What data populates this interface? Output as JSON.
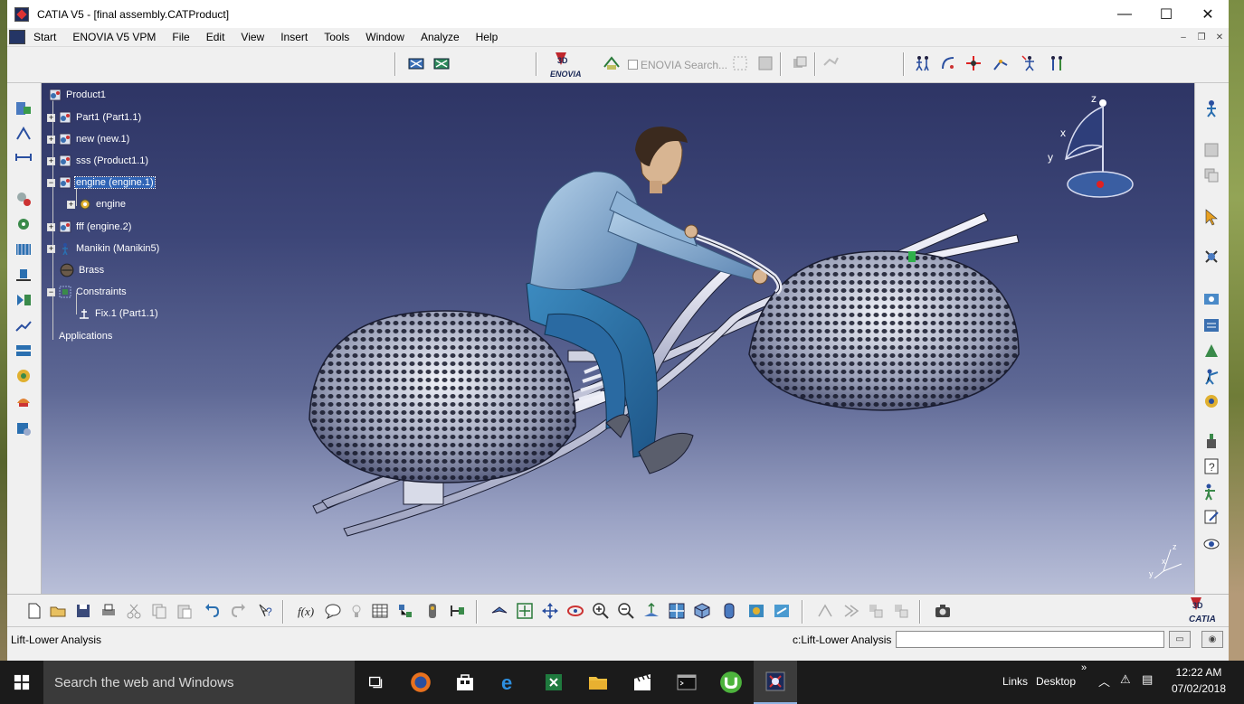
{
  "window": {
    "title": "CATIA V5 - [final assembly.CATProduct]",
    "controls": {
      "minimize": "—",
      "maximize": "☐",
      "close": "✕"
    }
  },
  "menubar": {
    "items": [
      "Start",
      "ENOVIA V5 VPM",
      "File",
      "Edit",
      "View",
      "Insert",
      "Tools",
      "Window",
      "Analyze",
      "Help"
    ],
    "mdi": {
      "minimize": "–",
      "restore": "❐",
      "close": "✕"
    }
  },
  "top_toolbar": {
    "enovia_search_label": "ENOVIA Search..."
  },
  "spec_tree": {
    "nodes": [
      {
        "label": "Product1",
        "icon": "product-icon"
      },
      {
        "label": "Part1 (Part1.1)",
        "icon": "part-icon"
      },
      {
        "label": "new (new.1)",
        "icon": "part-icon"
      },
      {
        "label": "sss (Product1.1)",
        "icon": "product-icon"
      },
      {
        "label": "engine (engine.1)",
        "icon": "product-icon",
        "selected": true
      },
      {
        "label": "engine",
        "icon": "gear-icon"
      },
      {
        "label": "fff (engine.2)",
        "icon": "product-icon"
      },
      {
        "label": "Manikin (Manikin5)",
        "icon": "manikin-icon"
      },
      {
        "label": "Brass",
        "icon": "material-icon"
      },
      {
        "label": "Constraints",
        "icon": "constraints-icon"
      },
      {
        "label": "Fix.1 (Part1.1)",
        "icon": "fix-constraint-icon"
      },
      {
        "label": "Applications",
        "icon": ""
      }
    ]
  },
  "compass": {
    "x": "x",
    "y": "y",
    "z": "z"
  },
  "mini_axis": {
    "x": "x",
    "y": "y",
    "z": "z"
  },
  "status": {
    "left": "Lift-Lower Analysis",
    "right": "c:Lift-Lower Analysis",
    "command_value": ""
  },
  "taskbar": {
    "search_placeholder": "Search the web and Windows",
    "links": "Links",
    "desktop": "Desktop",
    "time": "12:22 AM",
    "date": "07/02/2018",
    "apps": [
      "task-view-icon",
      "firefox-icon",
      "store-icon",
      "edge-icon",
      "excel-icon",
      "file-explorer-icon",
      "movie-maker-icon",
      "command-prompt-icon",
      "utorrent-icon",
      "catia-icon"
    ]
  },
  "colors": {
    "viewport_top": "#2e3565",
    "viewport_bottom": "#b9bfd8",
    "selection": "#2f63b5",
    "taskbar": "#1b1b1b"
  }
}
